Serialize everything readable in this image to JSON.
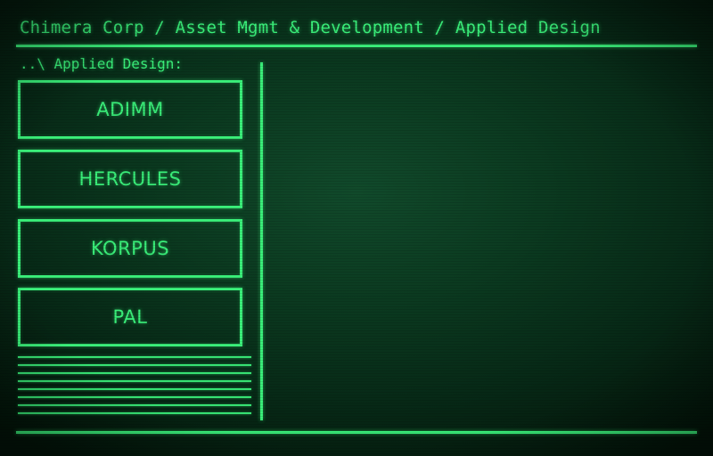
{
  "header": {
    "breadcrumb": "Chimera Corp / Asset Mgmt & Development / Applied Design"
  },
  "sidebar": {
    "section_label": "..\\ Applied Design:",
    "items": [
      {
        "label": "ADIMM"
      },
      {
        "label": "HERCULES"
      },
      {
        "label": "KORPUS"
      },
      {
        "label": "PAL"
      }
    ]
  },
  "colors": {
    "phosphor": "#3af07a",
    "background": "#0b3a20"
  }
}
